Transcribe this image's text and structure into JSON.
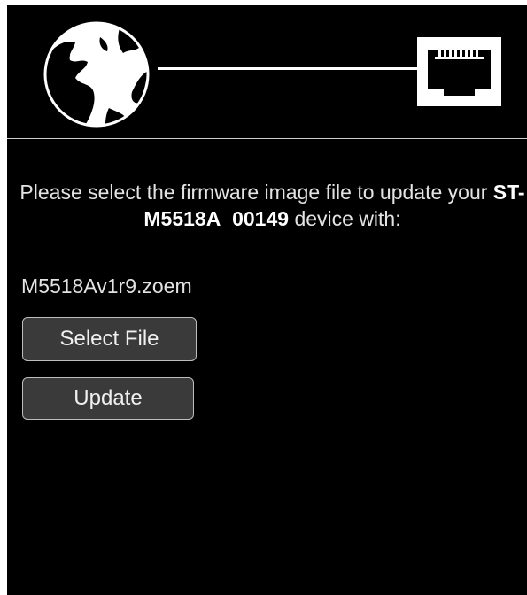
{
  "header": {
    "globe_icon": "globe-icon",
    "port_icon": "ethernet-port-icon"
  },
  "prompt": {
    "before": "Please select the firmware image file to update your ",
    "device": "ST-M5518A_00149",
    "after": " device with:"
  },
  "file": {
    "name": "M5518Av1r9.zoem"
  },
  "buttons": {
    "select_label": "Select File",
    "update_label": "Update"
  },
  "colors": {
    "background": "#000000",
    "text": "#e3e3e3",
    "button_bg": "#3a3a3a",
    "button_border": "#bdbdbd"
  }
}
